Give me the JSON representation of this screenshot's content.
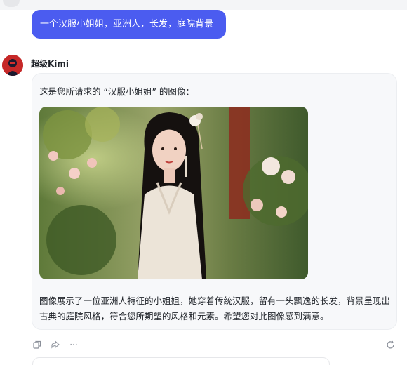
{
  "user_message": {
    "text": "一个汉服小姐姐，亚洲人，长发，庭院背景"
  },
  "assistant": {
    "name": "超级Kimi",
    "intro": "这是您所请求的 “汉服小姐姐” 的图像：",
    "image_alt": "汉服小姐姐",
    "body": "图像展示了一位亚洲人特征的小姐姐，她穿着传统汉服，留有一头飘逸的长发，背景呈现出古典的庭院风格，符合您所期望的风格和元素。希望您对此图像感到满意。"
  },
  "actions": {
    "icons": [
      "copy-icon",
      "share-icon",
      "more-icon",
      "refresh-icon"
    ],
    "more_label": "···"
  },
  "colors": {
    "accent": "#4b5cf0",
    "card_bg": "#f7f8fa",
    "icon_gray": "#8a8f99"
  }
}
